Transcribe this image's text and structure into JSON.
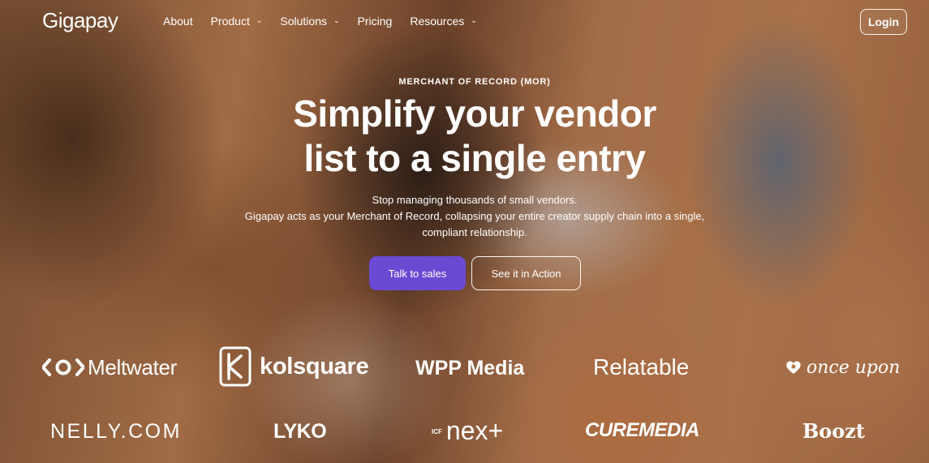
{
  "nav": {
    "logo": "Gigapay",
    "items": [
      {
        "label": "About",
        "has_dropdown": false
      },
      {
        "label": "Product",
        "has_dropdown": true
      },
      {
        "label": "Solutions",
        "has_dropdown": true
      },
      {
        "label": "Pricing",
        "has_dropdown": false
      },
      {
        "label": "Resources",
        "has_dropdown": true
      }
    ],
    "login": "Login",
    "chevron": "chevron-down-icon"
  },
  "hero": {
    "eyebrow": "MERCHANT OF RECORD (MOR)",
    "headline_line1": "Simplify your vendor",
    "headline_line2": "list to a single entry",
    "sub_line1": "Stop managing thousands of small vendors.",
    "sub_line2": "Gigapay acts as your Merchant of Record, collapsing your entire creator supply chain into a single,",
    "sub_line3": "compliant relationship.",
    "cta_primary": "Talk to sales",
    "cta_secondary": "See it in Action"
  },
  "colors": {
    "primary_button": "#6b4ad3"
  },
  "customers": {
    "row1": [
      "Meltwater",
      "kolsquare",
      "WPP Media",
      "Relatable",
      "once upon"
    ],
    "row2": [
      "NELLY.COM",
      "LYKO",
      "nex+",
      "CUREMEDIA",
      "Boozt"
    ],
    "nex_prefix": "ICF"
  }
}
